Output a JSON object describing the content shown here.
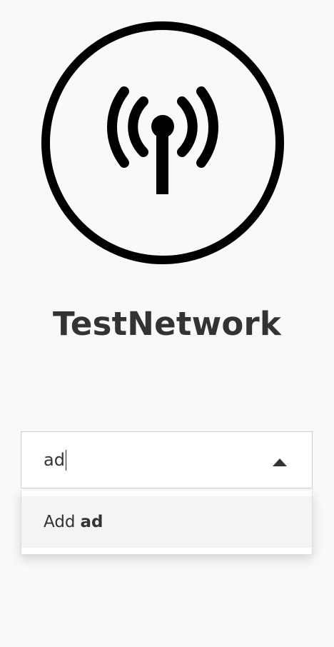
{
  "network": {
    "icon": "radio-tower-icon",
    "name": "TestNetwork"
  },
  "combobox": {
    "value": "ad",
    "toggle_icon": "caret-up-icon",
    "options": [
      {
        "prefix": "Add",
        "query": "ad"
      }
    ]
  },
  "colors": {
    "background": "#f8f9fb",
    "text": "#333333",
    "icon": "#000000",
    "option_highlight": "#f4f4f4"
  }
}
